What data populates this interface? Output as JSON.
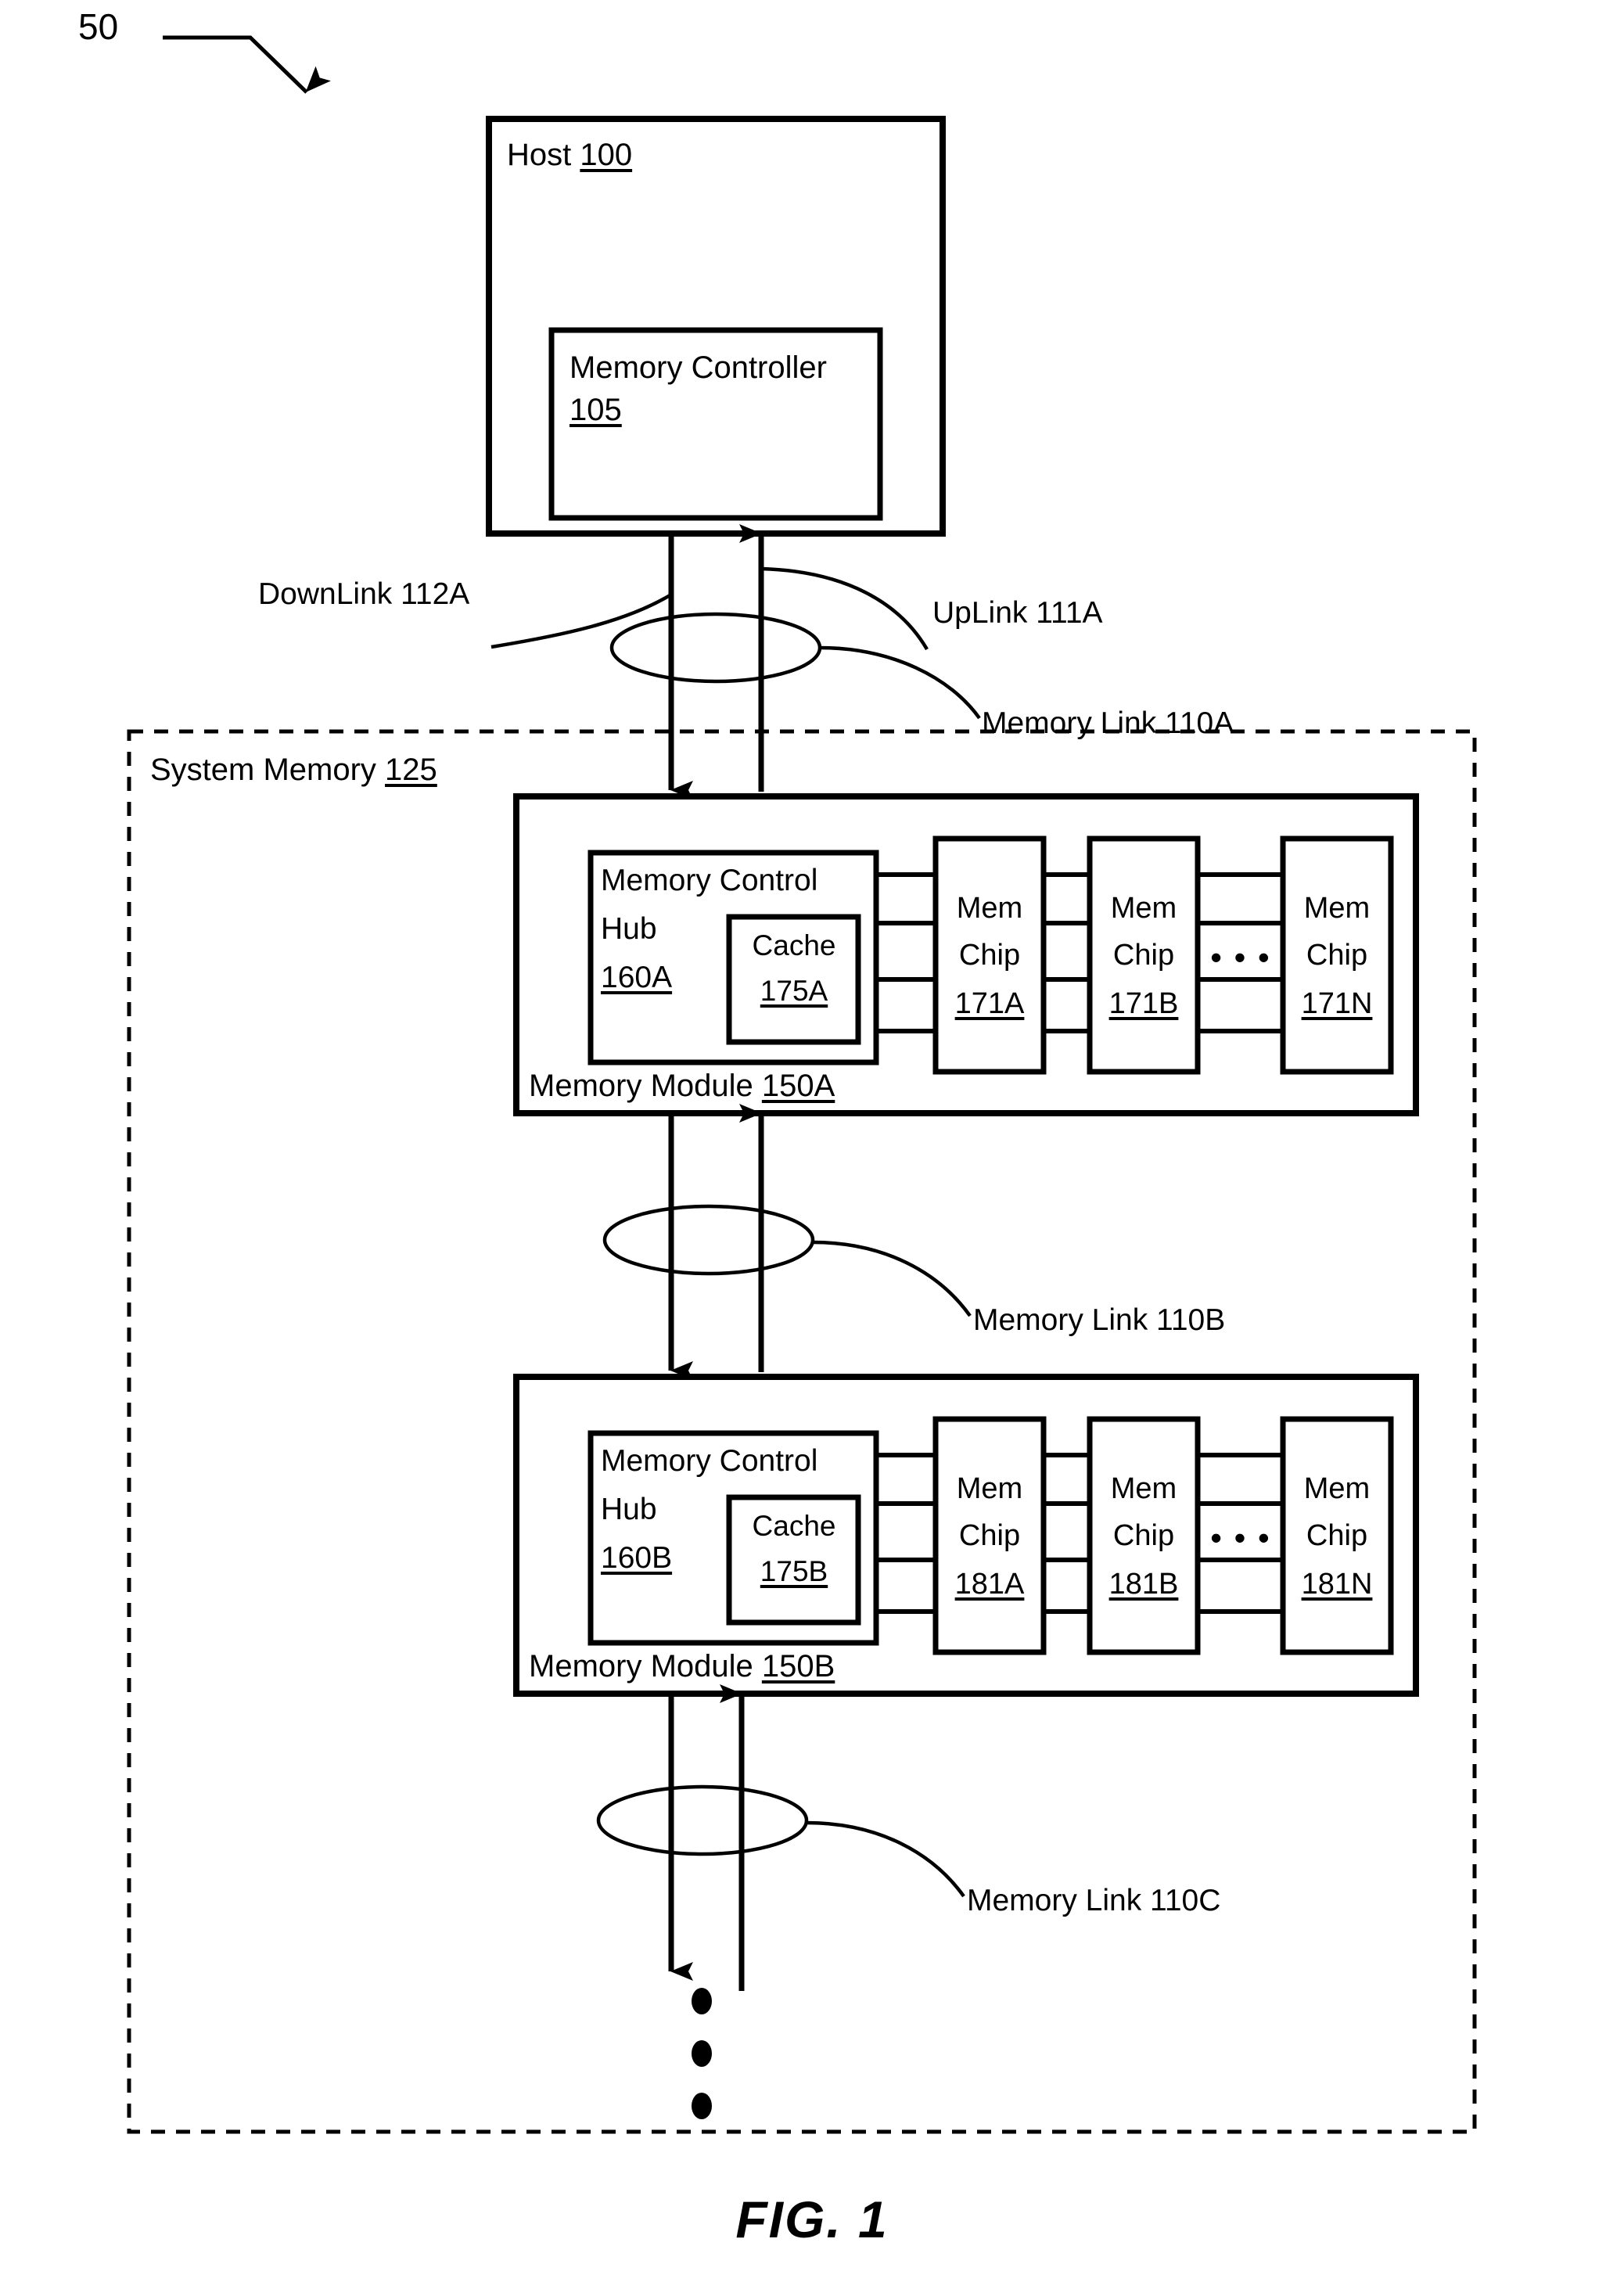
{
  "figure": {
    "caption": "FIG. 1",
    "reference_numeral": "50"
  },
  "host": {
    "label": "Host",
    "numeral": "100",
    "memory_controller": {
      "label": "Memory Controller",
      "numeral": "105"
    }
  },
  "links": {
    "downlink_a": "DownLink 112A",
    "uplink_a": "UpLink 111A",
    "memory_link_a": "Memory Link 110A",
    "memory_link_b": "Memory Link 110B",
    "memory_link_c": "Memory Link 110C"
  },
  "system_memory": {
    "label": "System Memory",
    "numeral": "125",
    "modules": [
      {
        "label": "Memory Module",
        "numeral": "150A",
        "hub": {
          "line1": "Memory Control",
          "line2": "Hub",
          "numeral": "160A",
          "cache": {
            "label": "Cache",
            "numeral": "175A"
          }
        },
        "chips": [
          {
            "line1": "Mem",
            "line2": "Chip",
            "numeral": "171A"
          },
          {
            "line1": "Mem",
            "line2": "Chip",
            "numeral": "171B"
          },
          {
            "line1": "Mem",
            "line2": "Chip",
            "numeral": "171N"
          }
        ],
        "chip_ellipsis": "• • •"
      },
      {
        "label": "Memory Module",
        "numeral": "150B",
        "hub": {
          "line1": "Memory Control",
          "line2": "Hub",
          "numeral": "160B",
          "cache": {
            "label": "Cache",
            "numeral": "175B"
          }
        },
        "chips": [
          {
            "line1": "Mem",
            "line2": "Chip",
            "numeral": "181A"
          },
          {
            "line1": "Mem",
            "line2": "Chip",
            "numeral": "181B"
          },
          {
            "line1": "Mem",
            "line2": "Chip",
            "numeral": "181N"
          }
        ],
        "chip_ellipsis": "• • •"
      }
    ],
    "continuation_dots": "vertical-ellipsis-3"
  },
  "colors": {
    "ink": "#000000",
    "paper": "#ffffff"
  }
}
